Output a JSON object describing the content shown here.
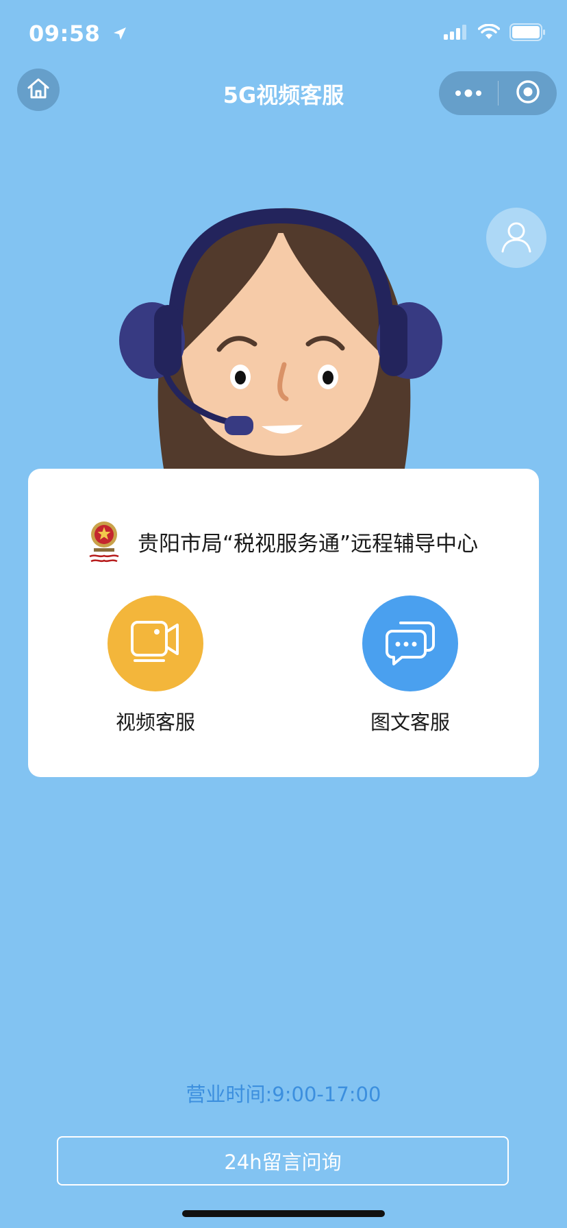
{
  "status_bar": {
    "time": "09:58"
  },
  "nav": {
    "title": "5G视频客服"
  },
  "card": {
    "org_name": "贵阳市局“税视服务通”远程辅导中心",
    "services": [
      {
        "label": "视频客服",
        "icon": "video-icon",
        "color": "#f3b63b"
      },
      {
        "label": "图文客服",
        "icon": "chat-icon",
        "color": "#4aa0ef"
      }
    ]
  },
  "footer": {
    "business_hours": "营业时间:9:00-17:00",
    "message_button_label": "24h留言问询"
  },
  "colors": {
    "background": "#82c3f2",
    "hours_text": "#3c8fde"
  }
}
